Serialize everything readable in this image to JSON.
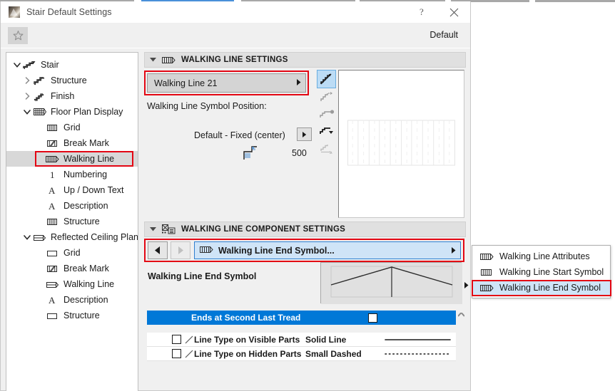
{
  "window": {
    "title": "Stair Default Settings",
    "help_label": "?",
    "close_label": "✕",
    "icon": "archicad-stair-icon"
  },
  "toolbar": {
    "favorites_icon": "star-icon",
    "default_label": "Default"
  },
  "tree": [
    {
      "label": "Stair",
      "level": 0,
      "twist": "down",
      "icon": "stair-icon",
      "selected": false
    },
    {
      "label": "Structure",
      "level": 1,
      "twist": "right",
      "icon": "structure-icon",
      "selected": false
    },
    {
      "label": "Finish",
      "level": 1,
      "twist": "right",
      "icon": "finish-icon",
      "selected": false
    },
    {
      "label": "Floor Plan Display",
      "level": 1,
      "twist": "down",
      "icon": "floor-plan-icon",
      "selected": false
    },
    {
      "label": "Grid",
      "level": 2,
      "twist": "none",
      "icon": "grid-icon",
      "selected": false
    },
    {
      "label": "Break Mark",
      "level": 2,
      "twist": "none",
      "icon": "break-mark-icon",
      "selected": false
    },
    {
      "label": "Walking Line",
      "level": 2,
      "twist": "none",
      "icon": "walking-line-icon",
      "selected": true
    },
    {
      "label": "Numbering",
      "level": 2,
      "twist": "none",
      "icon": "numbering-icon",
      "selected": false
    },
    {
      "label": "Up / Down Text",
      "level": 2,
      "twist": "none",
      "icon": "text-icon",
      "selected": false
    },
    {
      "label": "Description",
      "level": 2,
      "twist": "none",
      "icon": "text-icon",
      "selected": false
    },
    {
      "label": "Structure",
      "level": 2,
      "twist": "none",
      "icon": "grid-icon",
      "selected": false
    },
    {
      "label": "Reflected Ceiling Plan",
      "level": 1,
      "twist": "down",
      "icon": "rcp-icon",
      "selected": false
    },
    {
      "label": "Grid",
      "level": 2,
      "twist": "none",
      "icon": "rect-icon",
      "selected": false
    },
    {
      "label": "Break Mark",
      "level": 2,
      "twist": "none",
      "icon": "break-mark-icon",
      "selected": false
    },
    {
      "label": "Walking Line",
      "level": 2,
      "twist": "none",
      "icon": "rcp-icon",
      "selected": false
    },
    {
      "label": "Description",
      "level": 2,
      "twist": "none",
      "icon": "text-icon",
      "selected": false
    },
    {
      "label": "Structure",
      "level": 2,
      "twist": "none",
      "icon": "rect-icon",
      "selected": false
    }
  ],
  "walking_line_settings": {
    "section_title": "WALKING LINE SETTINGS",
    "section_icon": "walking-line-icon",
    "combo_value": "Walking Line 21",
    "position_label": "Walking Line Symbol Position:",
    "position_value": "Default - Fixed (center)",
    "offset_icon": "offset-dimension-icon",
    "offset_value": "500",
    "tool_icons": [
      "walkline-full-icon",
      "walkline-dim-icon",
      "walkline-node-icon",
      "walkline-dropdown-icon",
      "walkline-faint-icon"
    ]
  },
  "component_settings": {
    "section_title": "WALKING LINE COMPONENT SETTINGS",
    "section_icon": "component-settings-icon",
    "prev_label": "◀",
    "next_label": "▶",
    "component_value": "Walking Line End Symbol...",
    "component_icon": "walking-line-icon",
    "sub_label": "Walking Line End Symbol",
    "rows": [
      {
        "label": "Ends at Second Last Tread",
        "checked": false
      }
    ],
    "grid_rows": [
      {
        "label": "Line Type on Visible Parts",
        "value": "Solid Line",
        "pattern": "solid",
        "checked": false
      },
      {
        "label": "Line Type on Hidden Parts",
        "value": "Small Dashed",
        "pattern": "dashed",
        "checked": false
      }
    ]
  },
  "popup_menu": {
    "items": [
      {
        "label": "Walking Line Attributes",
        "icon": "walking-line-attr-icon",
        "selected": false
      },
      {
        "label": "Walking Line Start Symbol",
        "icon": "walking-line-start-icon",
        "selected": false
      },
      {
        "label": "Walking Line End Symbol",
        "icon": "walking-line-end-icon",
        "selected": true
      }
    ]
  },
  "colors": {
    "highlight_red": "#e30613",
    "selection_blue": "#0078d7",
    "light_blue": "#cfe4f7",
    "panel_gray": "#f0f0f0"
  }
}
